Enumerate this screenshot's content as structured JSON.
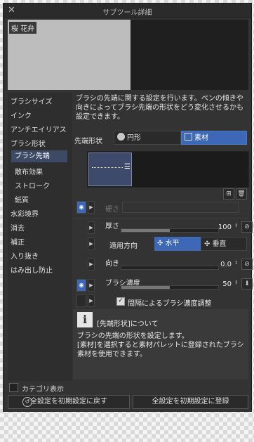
{
  "window": {
    "title": "サブツール詳細",
    "close_icon": "close-icon"
  },
  "preview": {
    "tool_name": "桜 花弁"
  },
  "sidebar": {
    "items": [
      {
        "label": "ブラシサイズ",
        "level": 0,
        "selected": false
      },
      {
        "label": "インク",
        "level": 0,
        "selected": false
      },
      {
        "label": "アンチエイリアス",
        "level": 0,
        "selected": false
      },
      {
        "label": "ブラシ形状",
        "level": 0,
        "selected": false
      },
      {
        "label": "ブラシ先端",
        "level": 1,
        "selected": true
      },
      {
        "label": "散布効果",
        "level": 1,
        "selected": false
      },
      {
        "label": "ストローク",
        "level": 1,
        "selected": false
      },
      {
        "label": "紙質",
        "level": 1,
        "selected": false
      },
      {
        "label": "水彩境界",
        "level": 0,
        "selected": false
      },
      {
        "label": "消去",
        "level": 0,
        "selected": false
      },
      {
        "label": "補正",
        "level": 0,
        "selected": false
      },
      {
        "label": "入り抜き",
        "level": 0,
        "selected": false
      },
      {
        "label": "はみ出し防止",
        "level": 0,
        "selected": false
      }
    ],
    "category_display": "カテゴリ表示"
  },
  "content": {
    "description": "ブラシの先端に関する設定を行います。ペンの傾きや向きによってブラシ先端の形状をどう変化させるかも設定できます。",
    "tip_shape": {
      "label": "先端形状",
      "options": [
        "円形",
        "素材"
      ],
      "selected": "素材"
    },
    "hardness": {
      "label": "硬さ",
      "disabled": true
    },
    "thickness": {
      "label": "厚さ",
      "value": "100",
      "fraction": 0.5
    },
    "apply_direction": {
      "label": "適用方向",
      "options": [
        "水平",
        "垂直"
      ],
      "selected": "水平"
    },
    "direction": {
      "label": "向き",
      "value": "0.0",
      "fraction": 0.0
    },
    "brush_density": {
      "label": "ブラシ濃度",
      "value": "50",
      "fraction": 0.5
    },
    "interval_density": {
      "label": "間隔によるブラシ濃度調整",
      "checked": true
    }
  },
  "help": {
    "title": "[先端形状]について",
    "body_line1": "ブラシの先端の形状を設定します。",
    "body_line2": "[素材]を選択すると素材パレットに登録されたブラシ素材を使用できます。"
  },
  "buttons": {
    "reset_all": "全設定を初期設定に戻す",
    "register_all": "全設定を初期設定に登録"
  }
}
